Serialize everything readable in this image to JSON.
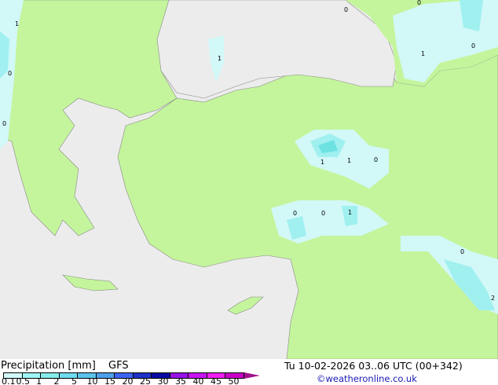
{
  "legend": {
    "title": "Precipitation [mm]",
    "model": "GFS",
    "datetime": "Tu 10-02-2026 03..06 UTC (00+342)",
    "credit": "©weatheronline.co.uk",
    "ticks": [
      "0.1",
      "0.5",
      "1",
      "2",
      "5",
      "10",
      "15",
      "20",
      "25",
      "30",
      "35",
      "40",
      "45",
      "50"
    ],
    "colors": [
      "#d2fafa",
      "#a0f5f5",
      "#87ebeb",
      "#6edcf0",
      "#5ac3ee",
      "#4ea0ea",
      "#3c64f0",
      "#1e32c8",
      "#0a0aa0",
      "#9614e6",
      "#c814f0",
      "#f01ef0",
      "#c800c8"
    ]
  },
  "map": {
    "colors": {
      "land": "#c4f59c",
      "sea": "#ececec",
      "precip_light": "#d2f8f8",
      "precip_mid": "#a0f0f0",
      "precip_high": "#6ee2e2"
    },
    "labels": [
      "0",
      "0",
      "1",
      "0",
      "1",
      "1",
      "0",
      "0",
      "1",
      "1",
      "0",
      "0",
      "0",
      "1",
      "2",
      "0",
      "1",
      "0",
      "1",
      "0"
    ]
  }
}
